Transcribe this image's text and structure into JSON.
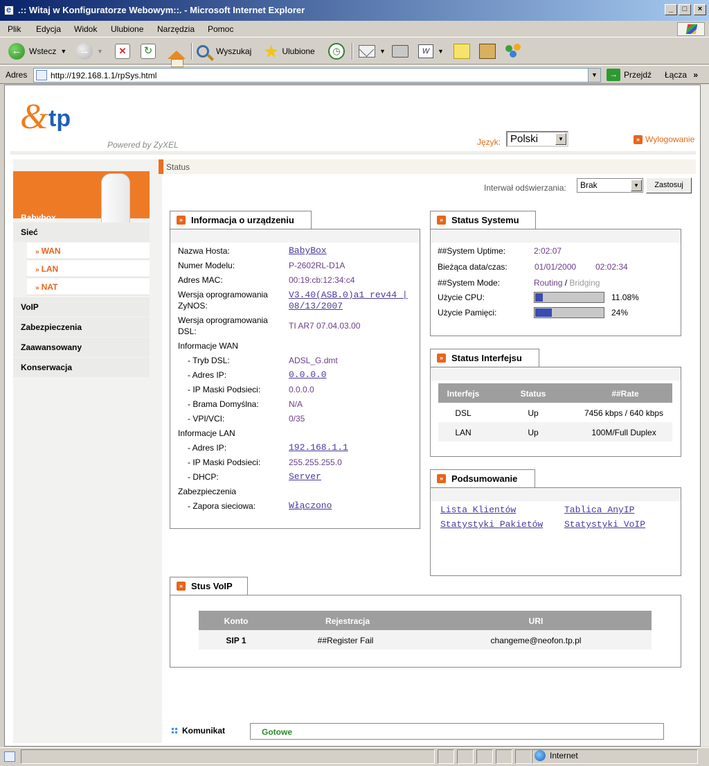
{
  "window": {
    "title": ".:: Witaj w Konfiguratorze Webowym::. - Microsoft Internet Explorer",
    "min": "_",
    "max": "□",
    "close": "×"
  },
  "menu": [
    "Plik",
    "Edycja",
    "Widok",
    "Ulubione",
    "Narzędzia",
    "Pomoc"
  ],
  "toolbar": {
    "back": "Wstecz",
    "search": "Wyszukaj",
    "favorites": "Ulubione"
  },
  "address": {
    "label": "Adres",
    "url": "http://192.168.1.1/rpSys.html",
    "go": "Przejdź",
    "links": "Łącza",
    "links_more": "»"
  },
  "header": {
    "logo_amp": "&",
    "logo_tp": "tp",
    "powered": "Powered by ZyXEL",
    "language_label": "Język:",
    "language_value": "Polski",
    "logout": "Wylogowanie"
  },
  "sidebar": {
    "device": "Babybox",
    "items": [
      {
        "label": "Sieć"
      },
      {
        "label": "VoIP"
      },
      {
        "label": "Zabezpieczenia"
      },
      {
        "label": "Zaawansowany"
      },
      {
        "label": "Konserwacja"
      }
    ],
    "subitems": [
      "WAN",
      "LAN",
      "NAT"
    ]
  },
  "breadcrumb": "Status",
  "refresh": {
    "label": "Interwał odświerzania:",
    "value": "Brak",
    "apply": "Zastosuj"
  },
  "device_info": {
    "title": "Informacja o urządzeniu",
    "host_label": "Nazwa Hosta:",
    "host": "BabyBox",
    "model_label": "Numer Modelu:",
    "model": "P-2602RL-D1A",
    "mac_label": "Adres MAC:",
    "mac": "00:19:cb:12:34:c4",
    "zynos_label_1": "Wersja oprogramowania",
    "zynos_label_2": "ZyNOS:",
    "zynos_1": "V3.40(ASB.0)a1 rev44 |",
    "zynos_2": "08/13/2007",
    "dsl_label_1": "Wersja oprogramowania",
    "dsl_label_2": "DSL:",
    "dsl": "TI AR7 07.04.03.00",
    "wan_header": "Informacje WAN",
    "wan_mode_label": "- Tryb DSL:",
    "wan_mode": "ADSL_G.dmt",
    "wan_ip_label": "- Adres IP:",
    "wan_ip": "0.0.0.0",
    "wan_mask_label": "- IP Maski Podsieci:",
    "wan_mask": "0.0.0.0",
    "wan_gw_label": "- Brama Domyślna:",
    "wan_gw": "N/A",
    "wan_vpi_label": "- VPI/VCI:",
    "wan_vpi": "0/35",
    "lan_header": "Informacje LAN",
    "lan_ip_label": "- Adres IP:",
    "lan_ip": "192.168.1.1",
    "lan_mask_label": "- IP Maski Podsieci:",
    "lan_mask": "255.255.255.0",
    "lan_dhcp_label": "- DHCP:",
    "lan_dhcp": "Server",
    "sec_header": "Zabezpieczenia",
    "fw_label": "- Zapora sieciowa:",
    "fw": "Włączono"
  },
  "system_status": {
    "title": "Status Systemu",
    "uptime_label": "##System Uptime:",
    "uptime": "2:02:07",
    "date_label": "Bieżąca data/czas:",
    "date": "01/01/2000",
    "time": "02:02:34",
    "mode_label": "##System Mode:",
    "mode_active": "Routing",
    "mode_sep": " / ",
    "mode_inactive": "Bridging",
    "cpu_label": "Użycie CPU:",
    "cpu": "11.08%",
    "cpu_fraction": 0.1108,
    "mem_label": "Użycie Pamięci:",
    "mem": "24%",
    "mem_fraction": 0.24
  },
  "interface_status": {
    "title": "Status Interfejsu",
    "headers": [
      "Interfejs",
      "Status",
      "##Rate"
    ],
    "rows": [
      [
        "DSL",
        "Up",
        "7456 kbps / 640 kbps"
      ],
      [
        "LAN",
        "Up",
        "100M/Full Duplex"
      ]
    ]
  },
  "summary": {
    "title": "Podsumowanie",
    "links": [
      "Lista Klientów",
      "Tablica AnyIP",
      "Statystyki Pakietów",
      "Statystyki VoIP"
    ]
  },
  "voip_status": {
    "title": "Stus VoIP",
    "headers": [
      "Konto",
      "Rejestracja",
      "URI"
    ],
    "rows": [
      [
        "SIP 1",
        "##Register Fail",
        "changeme@neofon.tp.pl"
      ]
    ]
  },
  "message": {
    "label": "Komunikat",
    "value": "Gotowe"
  },
  "statusbar": {
    "zone": "Internet"
  },
  "colors": {
    "accent": "#ee7a26",
    "link": "#4a3aa0",
    "bar": "#3b4bb2"
  }
}
